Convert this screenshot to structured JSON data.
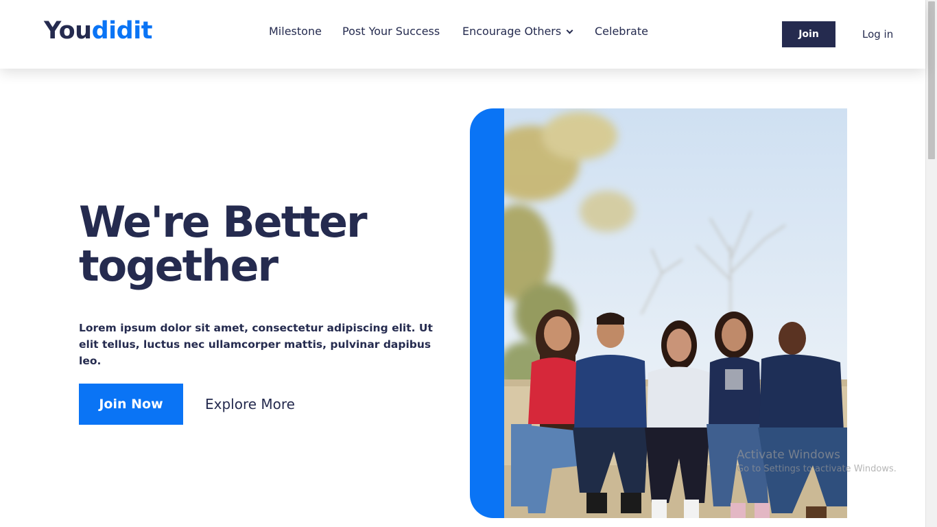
{
  "header": {
    "logo": {
      "part1": "You",
      "part2": "didit"
    },
    "nav": [
      {
        "label": "Milestone"
      },
      {
        "label": "Post Your Success"
      },
      {
        "label": "Encourage Others",
        "has_dropdown": true
      },
      {
        "label": "Celebrate"
      }
    ],
    "join_label": "Join",
    "login_label": "Log in"
  },
  "hero": {
    "title_line1": "We're Better",
    "title_line2": "together",
    "description": "Lorem ipsum dolor sit amet, consectetur adipiscing elit. Ut elit tellus, luctus nec ullamcorper mattis, pulvinar dapibus leo.",
    "primary_button": "Join Now",
    "secondary_button": "Explore More"
  },
  "watermark": {
    "line1": "Activate Windows",
    "line2": "Go to Settings to activate Windows."
  },
  "colors": {
    "navy": "#252b4f",
    "accent": "#0a74f5"
  },
  "icons": {
    "dropdown": "chevron-down-icon"
  }
}
